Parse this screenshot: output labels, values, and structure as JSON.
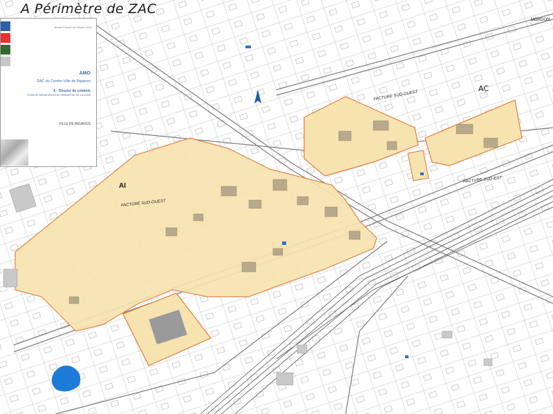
{
  "title": "A Périmètre de ZAC",
  "cartouche": {
    "small_header": "Année Février de Février 2010",
    "amo": "AMO",
    "zac_title": "ZAC du Centre-Ville de Biganos",
    "dossier": "4 - Dossier de création",
    "plan_caption": "PLAN DE DÉLIMITATION DU PÉRIMÈTRE DE LA ZONE",
    "ville": "VILLE DE BIGANOS",
    "swatch_colors": [
      "#2f5fa8",
      "#e6322e",
      "#2e6b2e",
      "#c7c7c7"
    ]
  },
  "map": {
    "perimeter_fill": "#f7e3b0",
    "perimeter_stroke": "#e07a3a",
    "labels": {
      "facture_sud_ouest_1": "FACTURE SUD-OUEST",
      "facture_sud_ouest_2": "FACTURE SUD-OUEST",
      "facture_sud_est": "FACTURE SUD-EST",
      "zone_ai": "AI",
      "zone_ac": "AC",
      "mordon": "MORDON"
    }
  }
}
